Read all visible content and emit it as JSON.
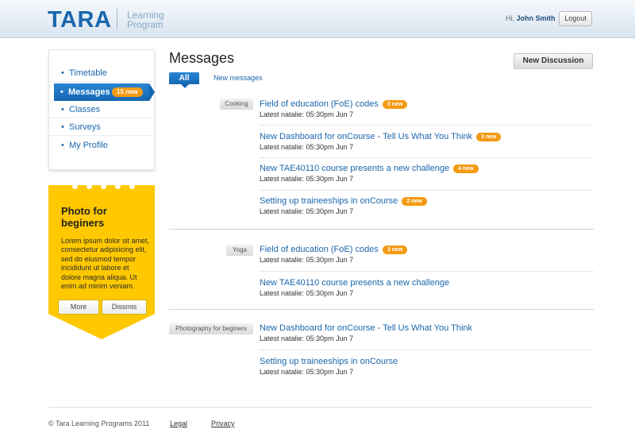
{
  "header": {
    "logo": "TARA",
    "logo_subtitle": "Learning Program",
    "greeting_prefix": "Hi,",
    "user_name": "John Smith",
    "logout_label": "Logout"
  },
  "sidebar": {
    "items": [
      {
        "label": "Timetable"
      },
      {
        "label": "Messages",
        "badge": "15 new",
        "active": true
      },
      {
        "label": "Classes"
      },
      {
        "label": "Surveys"
      },
      {
        "label": "My Profile"
      }
    ]
  },
  "promo": {
    "title": "Photo for beginers",
    "text": "Lorem ipsum dolor sit amet, consectetur adipisicing elit, sed do eiusmod tempor incididunt ut labore et dolore magna aliqua. Ut enim ad minim veniam.",
    "more_label": "More",
    "dismiss_label": "Dissmis"
  },
  "main": {
    "title": "Messages",
    "new_discussion_label": "New Discussion",
    "tabs": [
      {
        "label": "All",
        "active": true
      },
      {
        "label": "New messages"
      }
    ],
    "groups": [
      {
        "category": "Cooking",
        "messages": [
          {
            "title": "Field of education (FoE) codes",
            "badge": "3 new",
            "meta": "Latest natalie: 05:30pm Jun 7"
          },
          {
            "title": "New Dashboard for onCourse - Tell Us What You Think",
            "badge": "3 new",
            "meta": "Latest natalie: 05:30pm Jun 7"
          },
          {
            "title": "New TAE40110 course presents a new challenge",
            "badge": "4 new",
            "meta": "Latest natalie: 05:30pm Jun 7"
          },
          {
            "title": "Setting up traineeships in onCourse",
            "badge": "2 new",
            "meta": "Latest natalie: 05:30pm Jun 7"
          }
        ]
      },
      {
        "category": "Yoga",
        "messages": [
          {
            "title": "Field of education (FoE) codes",
            "badge": "3 new",
            "meta": "Latest natalie: 05:30pm Jun 7"
          },
          {
            "title": "New TAE40110 course presents a new challenge",
            "badge": "",
            "meta": "Latest natalie: 05:30pm Jun 7"
          }
        ]
      },
      {
        "category": "Photography for beginers",
        "messages": [
          {
            "title": "New Dashboard for onCourse - Tell Us What You Think",
            "badge": "",
            "meta": "Latest natalie: 05:30pm Jun 7"
          },
          {
            "title": "Setting up traineeships in onCourse",
            "badge": "",
            "meta": "Latest natalie: 05:30pm Jun 7"
          }
        ]
      }
    ]
  },
  "footer": {
    "copyright": "© Tara Learning Programs 2011",
    "links": [
      {
        "label": "Legal"
      },
      {
        "label": "Privacy"
      }
    ]
  },
  "colors": {
    "brand_blue": "#1b67ac",
    "badge_orange": "#f39a14",
    "promo_yellow": "#ffc800"
  }
}
